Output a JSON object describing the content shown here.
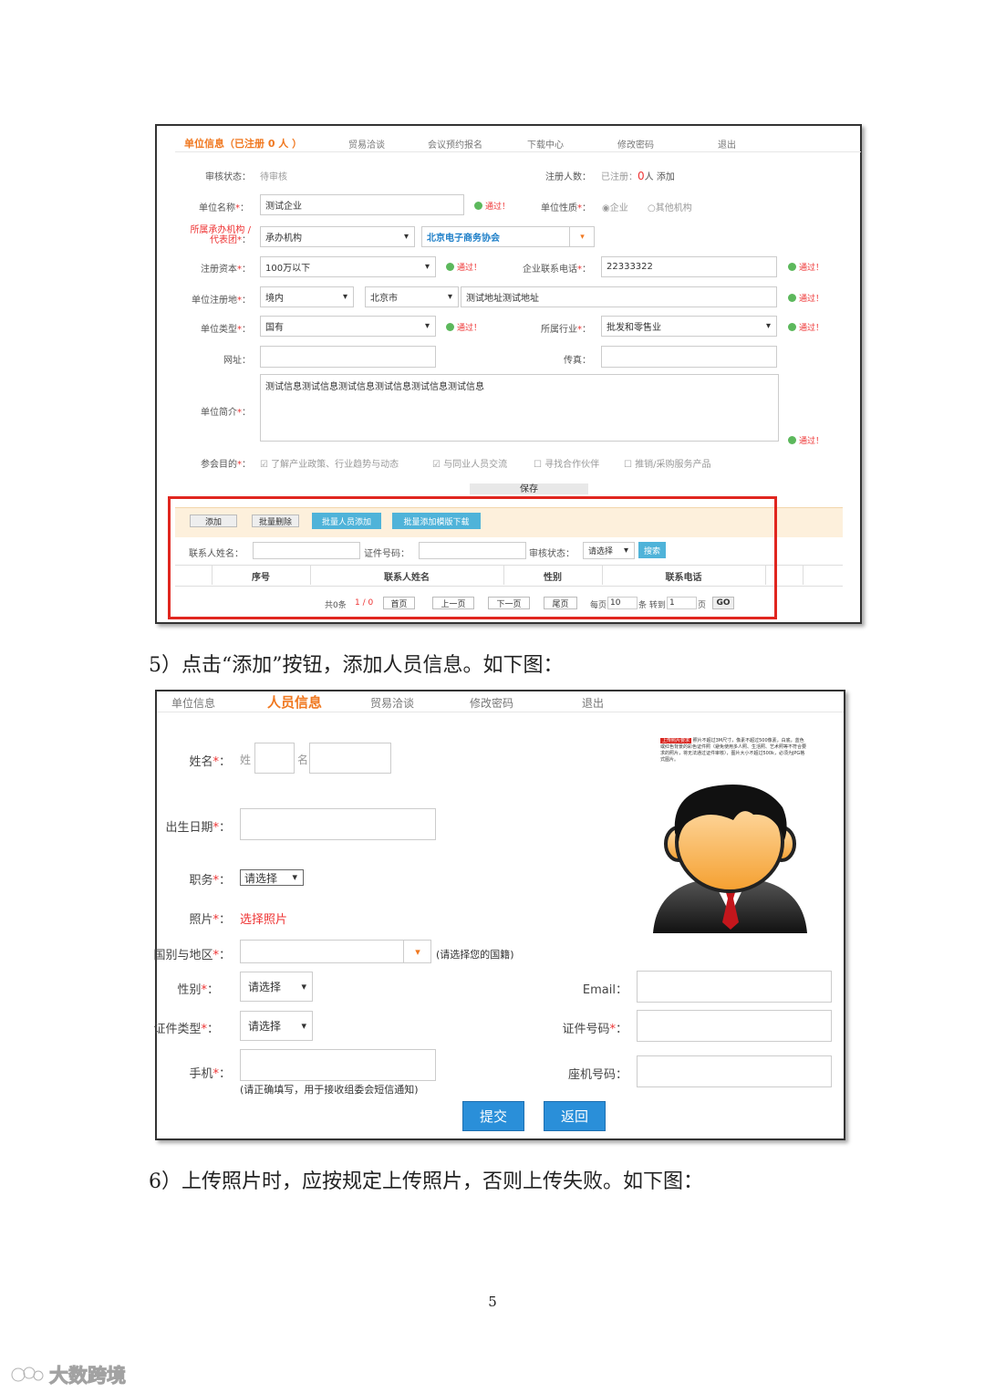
{
  "screenshot1": {
    "tabs": [
      {
        "label": "单位信息（已注册 0 人 ）",
        "active": true
      },
      {
        "label": "贸易洽谈"
      },
      {
        "label": "会议预约报名"
      },
      {
        "label": "下载中心"
      },
      {
        "label": "修改密码"
      },
      {
        "label": "退出"
      }
    ],
    "audit_label": "审核状态：",
    "audit_value": "待审核",
    "reg_count_label": "注册人数：",
    "reg_count_prefix": "已注册：",
    "reg_count_num": "0",
    "reg_count_suffix": "人 添加",
    "unit_name_label": "单位名称",
    "unit_name_value": "测试企业",
    "pass": "通过！",
    "unit_nature_label": "单位性质",
    "unit_nature_opt1": "企业",
    "unit_nature_opt2": "其他机构",
    "org_label_line1": "所属承办机构 /",
    "org_label_line2": "代表团",
    "org_select": "承办机构",
    "org_value": "北京电子商务协会",
    "capital_label": "注册资本",
    "capital_value": "100万以下",
    "phone_label": "企业联系电话",
    "phone_value": "22333322",
    "reg_place_label": "单位注册地",
    "reg_place_1": "境内",
    "reg_place_2": "北京市",
    "reg_place_addr": "测试地址测试地址",
    "type_label": "单位类型",
    "type_value": "国有",
    "industry_label": "所属行业",
    "industry_value": "批发和零售业",
    "site_label": "网址：",
    "fax_label": "传真：",
    "intro_label": "单位简介",
    "intro_value": "测试信息测试信息测试信息测试信息测试信息测试信息",
    "purpose_label": "参会目的",
    "purposes": [
      {
        "label": "了解产业政策、行业趋势与动态",
        "checked": true
      },
      {
        "label": "与同业人员交流",
        "checked": true
      },
      {
        "label": "寻找合作伙伴",
        "checked": false
      },
      {
        "label": "推销/采购服务产品",
        "checked": false
      }
    ],
    "save_label": "保存",
    "toolbar": {
      "add": "添加",
      "batch_delete": "批量删除",
      "batch_add": "批量人员添加",
      "template_download": "批量添加模版下载"
    },
    "search": {
      "name_label": "联系人姓名：",
      "id_label": "证件号码：",
      "status_label": "审核状态：",
      "status_value": "请选择",
      "search_btn": "搜索"
    },
    "table_headers": [
      "序号",
      "联系人姓名",
      "性别",
      "联系电话"
    ],
    "pager": {
      "total": "共0条",
      "page": "1 / 0",
      "first": "首页",
      "prev": "上一页",
      "next": "下一页",
      "last": "尾页",
      "per_page_prefix": "每页",
      "per_page": "10",
      "per_page_suffix": "条 转到",
      "goto": "1",
      "page_suffix": "页",
      "go": "GO"
    }
  },
  "para1": "5）点击“添加”按钮，添加人员信息。如下图：",
  "screenshot2": {
    "tabs": [
      {
        "label": "单位信息"
      },
      {
        "label": "人员信息",
        "active": true
      },
      {
        "label": "贸易洽谈"
      },
      {
        "label": "修改密码"
      },
      {
        "label": "退出"
      }
    ],
    "name_label": "姓名",
    "surname_ph": "姓",
    "given_ph": "名",
    "dob_label": "出生日期",
    "position_label": "职务",
    "position_value": "请选择",
    "photo_label": "照片",
    "photo_link": "选择照片",
    "country_label": "国别与地区",
    "country_hint": "(请选择您的国籍)",
    "gender_label": "性别",
    "gender_value": "请选择",
    "idtype_label": "证件类型",
    "idtype_value": "请选择",
    "mobile_label": "手机",
    "mobile_hint": "(请正确填写，用于接收组委会短信通知)",
    "email_label": "Email：",
    "idnum_label": "证件号码",
    "landline_label": "座机号码：",
    "submit": "提交",
    "back": "返回",
    "photo_req_tag": "上传照片要求",
    "photo_req_text": "照片不超过3M尺寸，像素不超过500像素，白底，蓝色或红色背景的彩色证件照（避免使用多人照、生活照、艺术照等不符合要求的照片，将无法通过证件审核），图片大小不超过500k，必须为JPG格式图片。"
  },
  "para2": "6）上传照片时，应按规定上传照片，否则上传失败。如下图：",
  "page_number": "5",
  "watermark": "大数跨境",
  "colors": {
    "accent_orange": "#f07820",
    "blue_button": "#4fb3d9",
    "highlight_red": "#e0261f",
    "submit_blue": "#2a8fd9"
  }
}
